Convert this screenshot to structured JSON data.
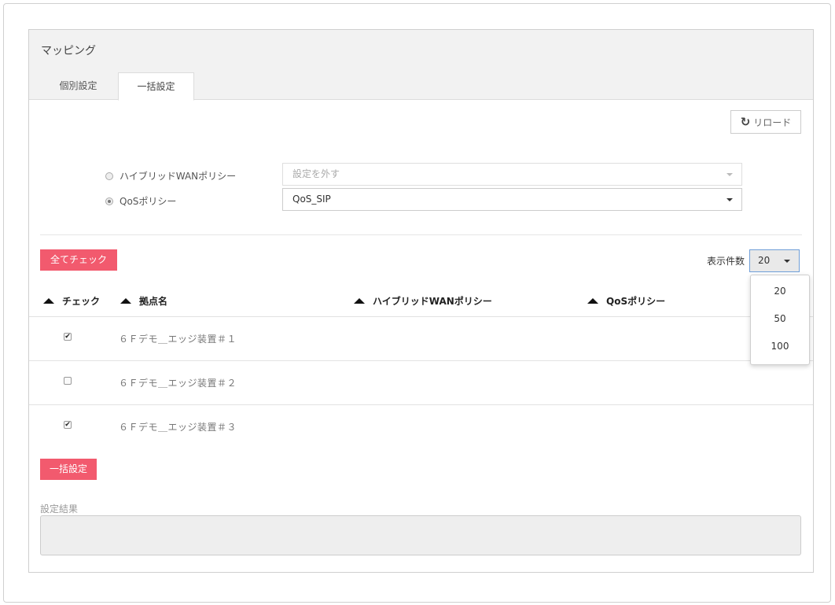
{
  "panel": {
    "title": "マッピング"
  },
  "tabs": [
    {
      "label": "個別設定",
      "active": false
    },
    {
      "label": "一括設定",
      "active": true
    }
  ],
  "reload": {
    "label": "リロード",
    "icon": "refresh-icon"
  },
  "policy": {
    "hybrid_label": "ハイブリッドWANポリシー",
    "hybrid_selected": false,
    "hybrid_value": "設定を外す",
    "qos_label": "QoSポリシー",
    "qos_selected": true,
    "qos_value": "QoS_SIP"
  },
  "actions": {
    "check_all": "全てチェック",
    "bulk_set": "一括設定"
  },
  "pagination": {
    "label": "表示件数",
    "selected": "20",
    "options": [
      "20",
      "50",
      "100"
    ]
  },
  "table": {
    "headers": [
      "チェック",
      "拠点名",
      "ハイブリッドWANポリシー",
      "QoSポリシー"
    ],
    "rows": [
      {
        "checked": true,
        "name": "６Ｆデモ＿エッジ装置＃１"
      },
      {
        "checked": false,
        "name": "６Ｆデモ＿エッジ装置＃２"
      },
      {
        "checked": true,
        "name": "６Ｆデモ＿エッジ装置＃３"
      }
    ]
  },
  "result": {
    "label": "設定結果",
    "value": ""
  },
  "colors": {
    "accent": "#f25a6e",
    "focus_border": "#6f9ed8"
  }
}
